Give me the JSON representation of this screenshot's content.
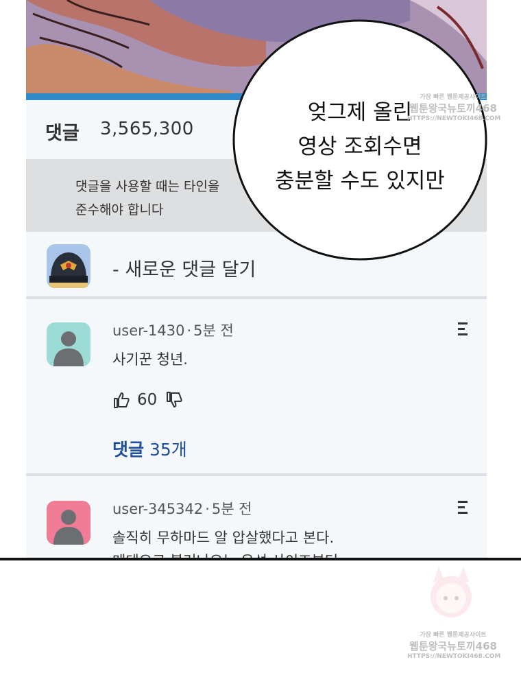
{
  "comments_header": {
    "label": "댓글",
    "count": "3,565,300"
  },
  "notice": {
    "line1": "댓글을 사용할 때는 타인을",
    "line2": "준수해야 합니다"
  },
  "new_comment": {
    "label": "- 새로운 댓글 달기"
  },
  "comments": [
    {
      "user": "user-1430",
      "time": "5분 전",
      "text": "사기꾼 청년.",
      "likes": "60",
      "replies_label": "댓글",
      "replies_count": "35개",
      "avatar_color": "#9ddbd6"
    },
    {
      "user": "user-345342",
      "time": "5분 전",
      "text": "솔직히 무하마드 알 압살했다고 본다.",
      "text2": "메테오로 불러나오는 유성 사이즈부터",
      "avatar_color": "#f07c96"
    }
  ],
  "separator": "·",
  "speech_bubble": {
    "line1": "엊그제 올린",
    "line2": "영상 조회수면",
    "line3": "충분할 수도 있지만"
  },
  "watermark": {
    "line1": "가장 빠른 웹툰제공사이트",
    "line2": "웹툰왕국뉴토끼468",
    "line3": "HTTPS://NEWTOKI468.COM"
  },
  "colors": {
    "accent": "#2f88c8",
    "link": "#1f4e9c",
    "panel_bg": "#f4f8fb",
    "notice_bg": "#dedfe1"
  },
  "icons": [
    "police-cap-icon",
    "user-silhouette-icon",
    "thumbs-up-icon",
    "thumbs-down-icon",
    "more-menu-icon"
  ]
}
